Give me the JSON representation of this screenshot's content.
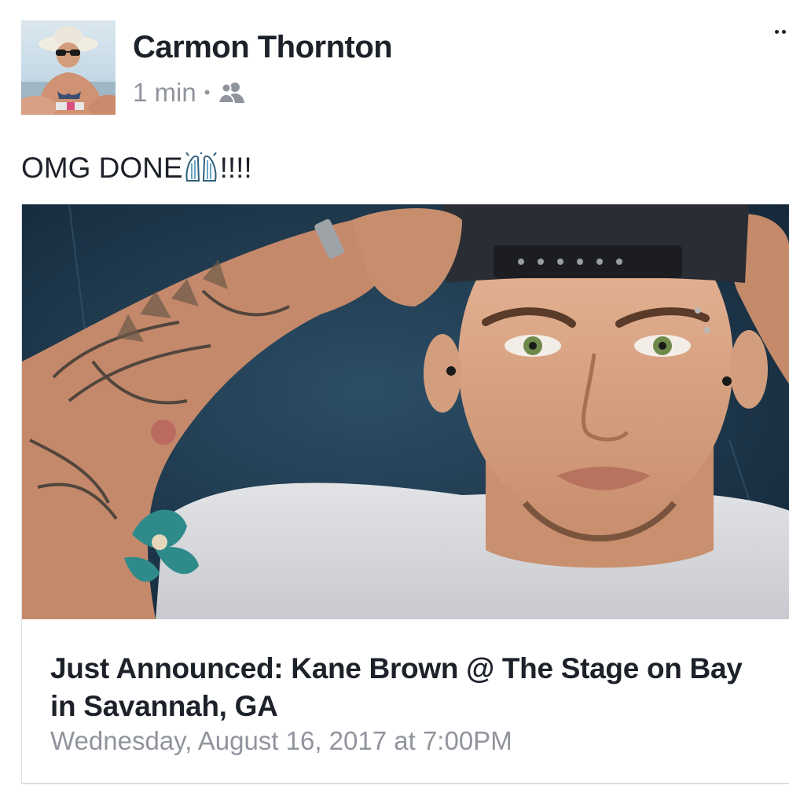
{
  "post": {
    "author_name": "Carmon Thornton",
    "timestamp": "1 min",
    "separator": "•",
    "audience_icon": "friends-icon",
    "status_text_before": "OMG DONE",
    "status_emoji": "raised-hands-emoji",
    "status_text_after": "!!!!",
    "more_icon": "more-options-icon"
  },
  "link_card": {
    "title": "Just Announced: Kane Brown @ The Stage on Bay in Savannah, GA",
    "subtitle": "Wednesday, August 16, 2017 at 7:00PM",
    "image": "promo-photo"
  },
  "colors": {
    "text_primary": "#1d2129",
    "text_secondary": "#90949c",
    "card_border": "#dddfe2",
    "photo_background": "#1f3a4e"
  }
}
